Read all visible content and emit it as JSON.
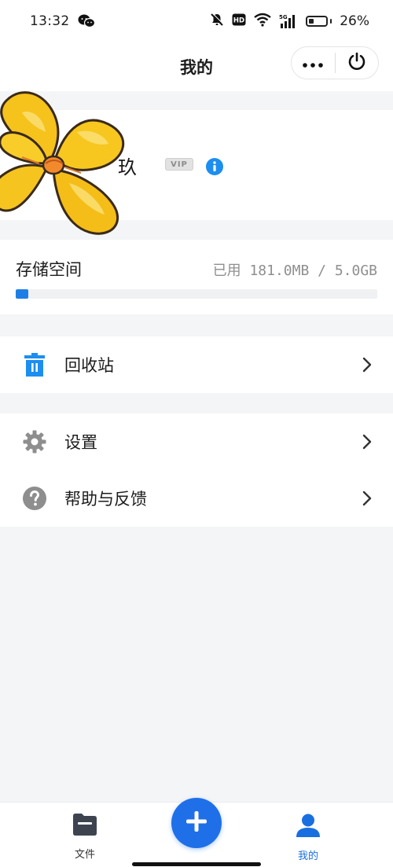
{
  "status_bar": {
    "time": "13:32",
    "battery_percent": "26%",
    "network": "5G",
    "hd_label": "HD",
    "icons": [
      "wechat-icon",
      "mute-icon",
      "hd-icon",
      "wifi-icon",
      "signal-icon",
      "battery-icon"
    ]
  },
  "header": {
    "title": "我的",
    "more_icon": "more-dots-icon",
    "power_icon": "power-icon"
  },
  "profile": {
    "name": "玖",
    "vip_badge": "VIP",
    "info_icon": "info-icon",
    "avatar": "yellow-flower-avatar"
  },
  "storage": {
    "title": "存储空间",
    "usage": "已用 181.0MB / 5.0GB",
    "used_fraction": 0.035,
    "bar_color": "#1d7fe6"
  },
  "menu": {
    "recycle": {
      "label": "回收站",
      "icon": "trash-icon",
      "icon_color": "#1d8ef0"
    },
    "settings": {
      "label": "设置",
      "icon": "gear-icon",
      "icon_color": "#8e8e8e"
    },
    "help": {
      "label": "帮助与反馈",
      "icon": "help-icon",
      "icon_color": "#8e8e8e"
    }
  },
  "bottom_nav": {
    "files": {
      "label": "文件",
      "icon": "folder-icon"
    },
    "add": {
      "icon": "plus-icon"
    },
    "me": {
      "label": "我的",
      "icon": "user-icon",
      "active_color": "#1a6fe0"
    }
  }
}
